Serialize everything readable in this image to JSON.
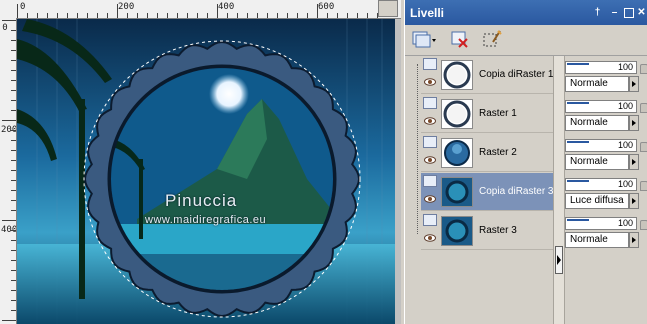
{
  "ruler": {
    "top_labels": [
      "0",
      "200",
      "400",
      "600"
    ],
    "left_labels": [
      "0",
      "200",
      "400"
    ]
  },
  "canvas": {
    "watermark_name": "Pinuccia",
    "watermark_site": "www.maidiregrafica.eu"
  },
  "palette": {
    "title": "Livelli",
    "title_buttons": [
      "pin-icon",
      "minimize-icon",
      "restore-icon",
      "close-icon"
    ],
    "toolbar": [
      "new-layer-icon",
      "dropdown-arrow-icon",
      "delete-layer-icon",
      "edit-selection-icon"
    ]
  },
  "layers": [
    {
      "name": "Copia diRaster 1",
      "thumb": "ring-gray",
      "selected": false
    },
    {
      "name": "Raster 1",
      "thumb": "ring-gray",
      "selected": false
    },
    {
      "name": "Raster 2",
      "thumb": "circle-blue",
      "selected": false
    },
    {
      "name": "Copia diRaster 3",
      "thumb": "scene-circle",
      "selected": true
    },
    {
      "name": "Raster 3",
      "thumb": "scene-circle",
      "selected": false
    }
  ],
  "layer_props": [
    {
      "opacity": "100",
      "blend": "Normale"
    },
    {
      "opacity": "100",
      "blend": "Normale"
    },
    {
      "opacity": "100",
      "blend": "Normale"
    },
    {
      "opacity": "100",
      "blend": "Luce diffusa"
    },
    {
      "opacity": "100",
      "blend": "Normale"
    }
  ],
  "colors": {
    "title_bar": "#2a58a0",
    "selected_layer": "#7c92b8"
  }
}
